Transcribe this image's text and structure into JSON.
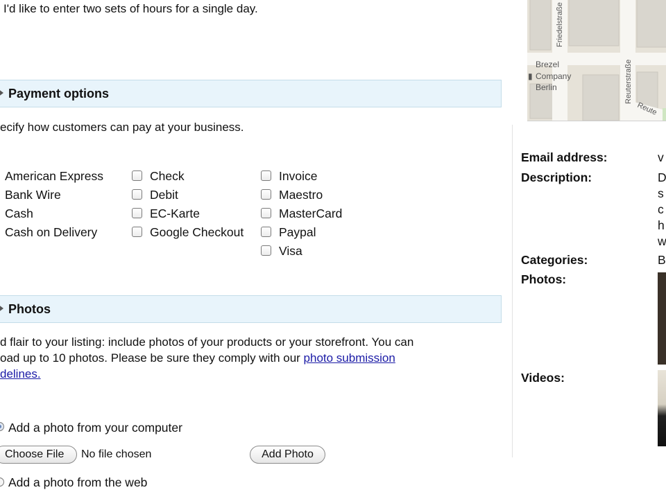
{
  "hours": {
    "multi_hours_text": "I'd like to enter two sets of hours for a single day."
  },
  "payment": {
    "header_title": "Payment options",
    "description": "ecify how customers can pay at your business.",
    "columns": [
      [
        "American Express",
        "Bank Wire",
        "Cash",
        "Cash on Delivery"
      ],
      [
        "Check",
        "Debit",
        "EC-Karte",
        "Google Checkout"
      ],
      [
        "Invoice",
        "Maestro",
        "MasterCard",
        "Paypal",
        "Visa"
      ]
    ]
  },
  "photos": {
    "header_title": "Photos",
    "desc_line1": "d flair to your listing: include photos of your products or your storefront. You can",
    "desc_line2_prefix": "oad up to 10 photos. Please be sure they comply with our ",
    "desc_link_part1": "photo submission",
    "desc_link_part2": "delines.",
    "option_computer": "Add a photo from your computer",
    "choose_file_label": "Choose File",
    "no_file_text": "No file chosen",
    "add_photo_label": "Add Photo",
    "option_web": "Add a photo from the web"
  },
  "map": {
    "street_1": "Friedelstraße",
    "street_2": "Reuterstraße",
    "street_3": "Reute",
    "place_line1": "Brezel",
    "place_line2": "Company",
    "place_line3": "Berlin"
  },
  "summary": {
    "email_label": "Email address:",
    "email_value": "v",
    "description_label": "Description:",
    "description_lines": [
      "D",
      "s",
      "c",
      "h",
      "w"
    ],
    "categories_label": "Categories:",
    "categories_value": "B",
    "photos_label": "Photos:",
    "videos_label": "Videos:"
  }
}
